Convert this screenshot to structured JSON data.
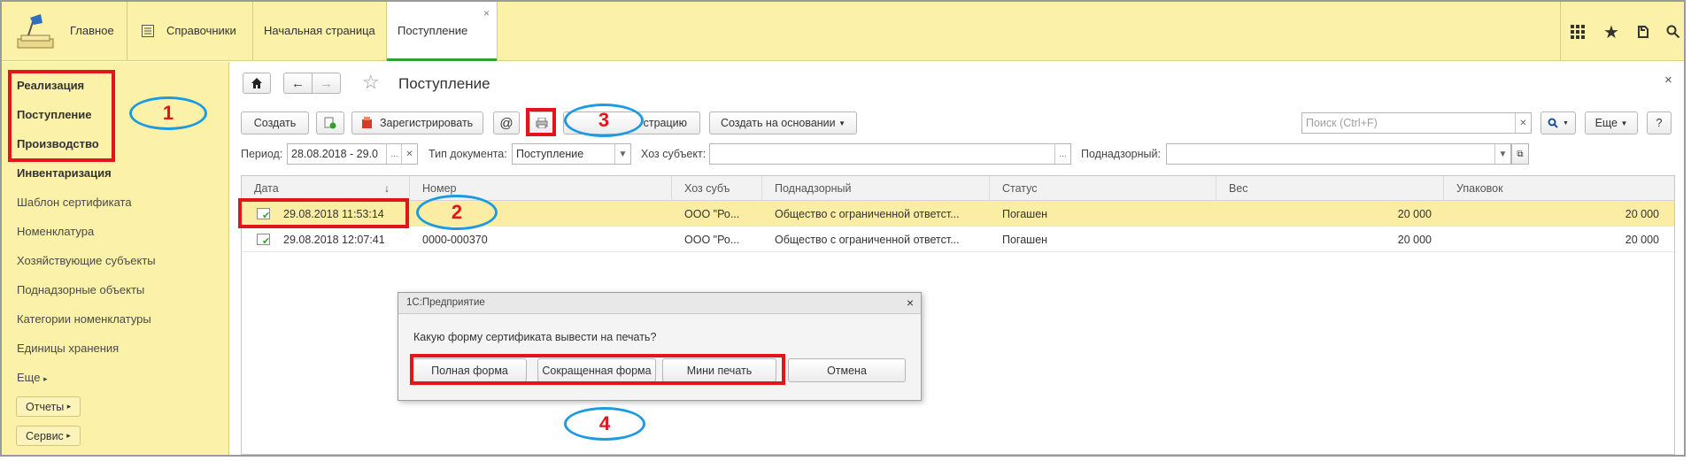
{
  "topbar": {
    "home_label": "Главное",
    "catalogs_label": "Справочники",
    "tab_start": "Начальная страница",
    "tab_active": "Поступление",
    "tab_close": "×",
    "icons": [
      "grid-icon",
      "star-icon",
      "history-icon",
      "search-icon"
    ]
  },
  "sidebar": {
    "items": [
      {
        "label": "Реализация"
      },
      {
        "label": "Поступление"
      },
      {
        "label": "Производство"
      },
      {
        "label": "Инвентаризация"
      },
      {
        "label": "Шаблон сертификата"
      },
      {
        "label": "Номенклатура"
      },
      {
        "label": "Хозяйствующие субъекты"
      },
      {
        "label": "Поднадзорные объекты"
      },
      {
        "label": "Категории номенклатуры"
      },
      {
        "label": "Единицы хранения"
      },
      {
        "label": "Еще"
      }
    ],
    "reports_label": "Отчеты",
    "service_label": "Сервис"
  },
  "form": {
    "title": "Поступление",
    "close": "×",
    "toolbar": {
      "create": "Создать",
      "register": "Зарегистрировать",
      "at": "@",
      "cancel_registration_partial": "страцию",
      "create_based_on": "Создать на основании",
      "search_placeholder": "Поиск (Ctrl+F)",
      "more": "Еще",
      "help": "?"
    },
    "filters": {
      "period_label": "Период:",
      "period_value": "28.08.2018 - 29.0",
      "doc_type_label": "Тип документа:",
      "doc_type_value": "Поступление",
      "subject_label": "Хоз субъект:",
      "subject_value": "",
      "supervised_label": "Поднадзорный:",
      "supervised_value": ""
    }
  },
  "table": {
    "columns": [
      "Дата",
      "Номер",
      "Хоз субъ",
      "Поднадзорный",
      "Статус",
      "Вес",
      "Упаковок"
    ],
    "sort_indicator": "↓",
    "rows": [
      {
        "date": "29.08.2018 11:53:14",
        "number": "",
        "subject": "ООО \"Ро...",
        "supervised": "Общество с ограниченной ответст...",
        "status": "Погашен",
        "weight": "20 000",
        "packages": "20 000"
      },
      {
        "date": "29.08.2018 12:07:41",
        "number": "0000-000370",
        "subject": "ООО \"Ро...",
        "supervised": "Общество с ограниченной ответст...",
        "status": "Погашен",
        "weight": "20 000",
        "packages": "20 000"
      }
    ]
  },
  "dialog": {
    "title": "1С:Предприятие",
    "close": "×",
    "question": "Какую форму сертификата вывести на печать?",
    "buttons": [
      "Полная форма",
      "Сокращенная форма",
      "Мини печать",
      "Отмена"
    ]
  },
  "annotations": [
    "1",
    "2",
    "3",
    "4"
  ],
  "colors": {
    "panel_yellow": "#fbf1a8",
    "selected_row": "#fbeda4",
    "annotation_red": "#e4141c",
    "annotation_blue": "#1e9be0",
    "active_tab_underline": "#2ea12e"
  }
}
